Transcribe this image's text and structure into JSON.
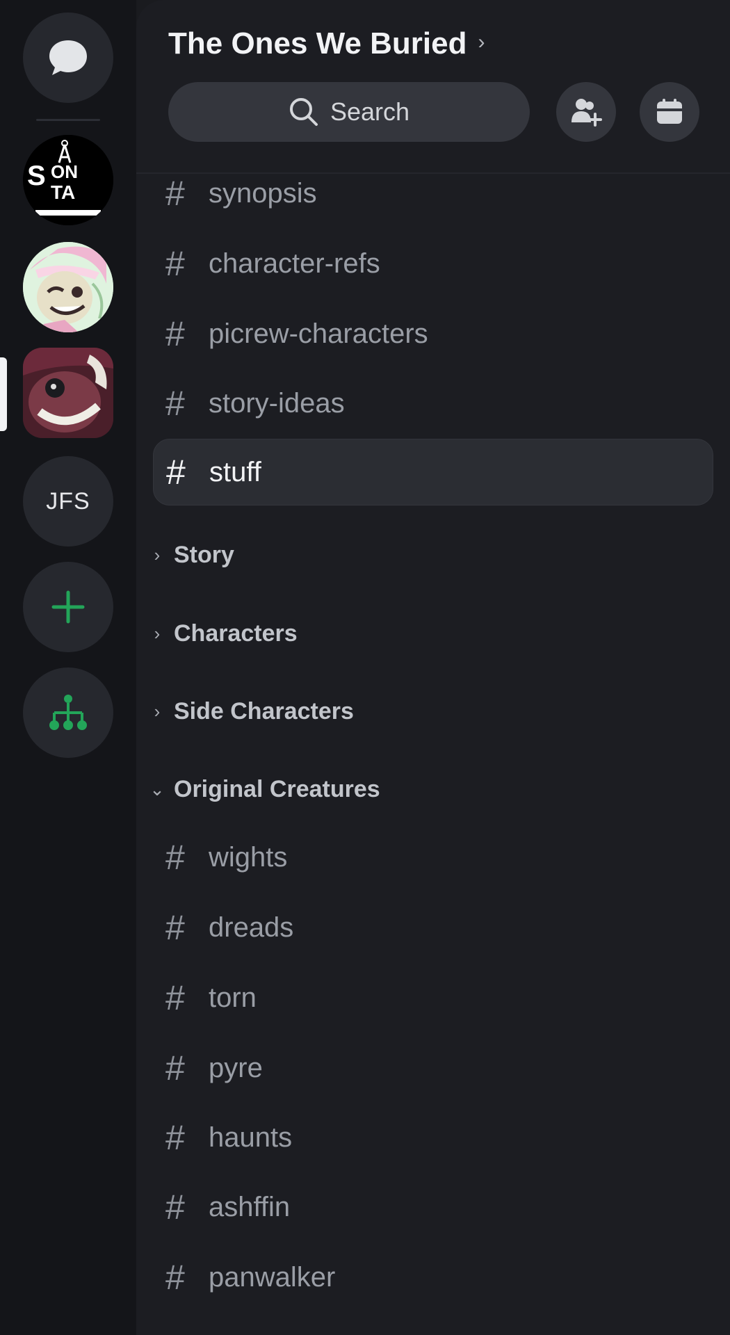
{
  "server_rail": {
    "jfs_label": "JFS",
    "server1_logo_text": "SON TA",
    "accent_green": "#23a559"
  },
  "header": {
    "server_name": "The Ones We Buried",
    "search_label": "Search"
  },
  "channels_top": [
    {
      "name": "synopsis"
    },
    {
      "name": "character-refs"
    },
    {
      "name": "picrew-characters"
    },
    {
      "name": "story-ideas"
    },
    {
      "name": "stuff",
      "selected": true
    }
  ],
  "categories": [
    {
      "label": "Story",
      "collapsed": true
    },
    {
      "label": "Characters",
      "collapsed": true
    },
    {
      "label": "Side Characters",
      "collapsed": true
    },
    {
      "label": "Original Creatures",
      "collapsed": false
    }
  ],
  "original_creatures_channels": [
    {
      "name": "wights"
    },
    {
      "name": "dreads"
    },
    {
      "name": "torn"
    },
    {
      "name": "pyre"
    },
    {
      "name": "haunts"
    },
    {
      "name": "ashffin"
    },
    {
      "name": "panwalker"
    }
  ]
}
